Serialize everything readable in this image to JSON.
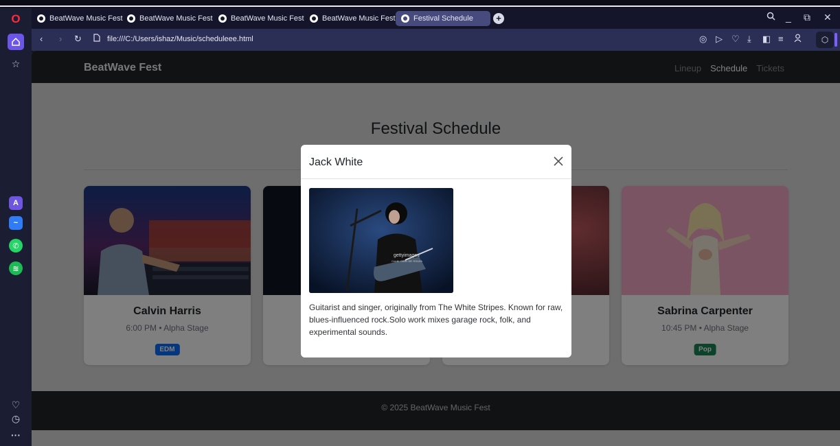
{
  "browser": {
    "tabs": [
      {
        "label": "BeatWave Music Fest",
        "active": false
      },
      {
        "label": "BeatWave Music Fest",
        "active": false
      },
      {
        "label": "BeatWave Music Fest",
        "active": false
      },
      {
        "label": "BeatWave Music Fest",
        "active": false
      },
      {
        "label": "Festival Schedule",
        "active": true
      }
    ],
    "new_tab": "+",
    "url": "file:///C:/Users/ishaz/Music/scheduleee.html",
    "accent": "#6c55e9"
  },
  "navbar": {
    "brand": "BeatWave Fest",
    "links": [
      "Lineup",
      "Schedule",
      "Tickets"
    ],
    "active_link": "Schedule"
  },
  "page": {
    "title": "Festival Schedule"
  },
  "cards": [
    {
      "name": "Calvin Harris",
      "time": "6:00 PM • Alpha Stage",
      "genre": "EDM",
      "genre_color": "#0d6efd"
    },
    {
      "name": "Sabrina Carpenter",
      "time": "10:45 PM • Alpha Stage",
      "genre": "Pop",
      "genre_color": "#198754"
    }
  ],
  "modal": {
    "title": "Jack White",
    "image_watermark": "gettyimages",
    "image_credit": "Credit: CARL DE SOUZA",
    "description": "Guitarist and singer, originally from The White Stripes. Known for raw, blues-influenced rock.Solo work mixes garage rock, folk, and experimental sounds."
  },
  "footer": {
    "text": "© 2025 BeatWave Music Fest"
  },
  "icons": {
    "sidebar": [
      "opera-logo",
      "home",
      "star",
      "aria",
      "messenger",
      "whatsapp",
      "spotify",
      "heart",
      "clock",
      "more"
    ],
    "toolbar": [
      "camera",
      "play",
      "heart",
      "download",
      "wallet",
      "menu",
      "profile",
      "extensions"
    ]
  }
}
